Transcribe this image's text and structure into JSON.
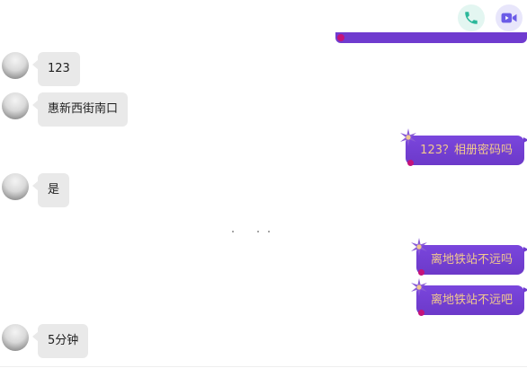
{
  "header": {
    "voice_call_icon": "phone-icon",
    "video_call_icon": "video-camera-icon",
    "colors": {
      "voice": "#2bb89a",
      "video": "#6b5ce7"
    }
  },
  "messages": [
    {
      "side": "incoming",
      "text": "123"
    },
    {
      "side": "incoming",
      "text": "惠新西街南口"
    },
    {
      "side": "outgoing",
      "text": "123？相册密码吗"
    },
    {
      "side": "incoming",
      "text": "是"
    },
    {
      "side": "outgoing",
      "text": "离地铁站不远吗"
    },
    {
      "side": "outgoing",
      "text": "离地铁站不远吧"
    },
    {
      "side": "incoming",
      "text": "5分钟"
    }
  ],
  "colors": {
    "outgoing_bubble": "#6f3bcf",
    "outgoing_text": "#f2c98d",
    "incoming_bubble": "#e9e9e9",
    "accent_dot": "#c4127a"
  }
}
